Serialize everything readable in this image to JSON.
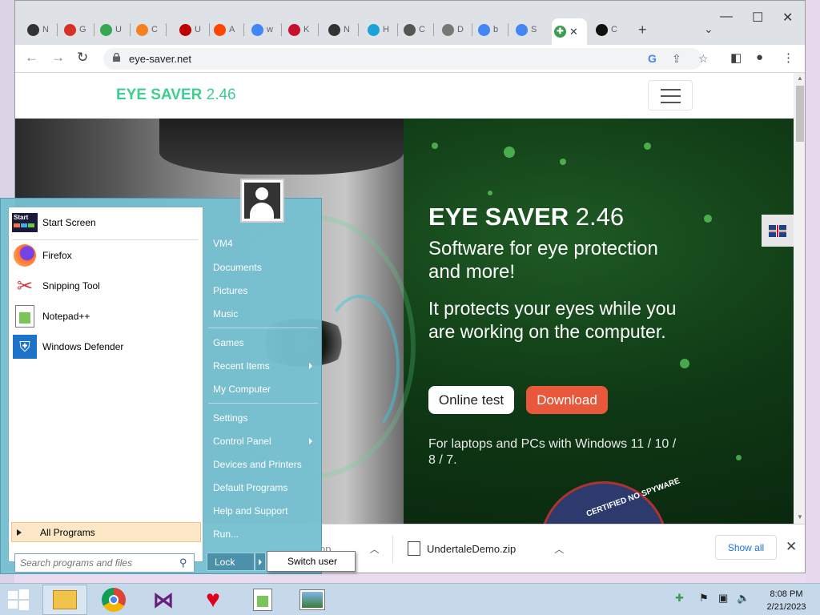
{
  "browser": {
    "tabs": [
      {
        "letter": "N",
        "color": "#333333"
      },
      {
        "letter": "G",
        "color": "#d93025"
      },
      {
        "letter": "U",
        "color": "#34a853"
      },
      {
        "letter": "C",
        "color": "#f48120"
      },
      {
        "letter": "U",
        "color": "#c00000"
      },
      {
        "letter": "A",
        "color": "#ff4500"
      },
      {
        "letter": "w",
        "color": "#4285f4"
      },
      {
        "letter": "K",
        "color": "#c8102e"
      },
      {
        "letter": "N",
        "color": "#333333"
      },
      {
        "letter": "H",
        "color": "#1aa3d9"
      },
      {
        "letter": "C",
        "color": "#555555"
      },
      {
        "letter": "D",
        "color": "#777777"
      },
      {
        "letter": "b",
        "color": "#4285f4"
      },
      {
        "letter": "S",
        "color": "#4285f4"
      },
      {
        "letter": "",
        "color": "#3a9d4f"
      },
      {
        "letter": "C",
        "color": "#111111"
      }
    ],
    "url": "eye-saver.net",
    "new_tab": "+",
    "tab_menu": "⌄",
    "win_minimize": "—",
    "win_maximize": "☐",
    "win_close": "✕"
  },
  "site": {
    "brand_name": "EYE SAVER",
    "brand_version": "2.46",
    "hero_title_name": "EYE SAVER",
    "hero_title_version": "2.46",
    "hero_subtitle": "Software for eye protection and more!",
    "hero_description": "It protects your eyes while you are working on the computer.",
    "online_test_label": "Online test",
    "download_label": "Download",
    "note": "For laptops and PCs with Windows 11 / 10 / 8 / 7.",
    "badge_text": "CERTIFIED NO SPYWARE",
    "accent_color": "#3ccf8e",
    "download_color": "#e8583a"
  },
  "downloads": {
    "item1_name": "op",
    "item2_name": "UndertaleDemo.zip",
    "show_all_label": "Show all",
    "close_icon": "✕"
  },
  "start_menu": {
    "pinned": [
      {
        "label": "Start Screen",
        "icon": "start-screen-icon"
      },
      {
        "label": "Firefox",
        "icon": "firefox-icon"
      },
      {
        "label": "Snipping Tool",
        "icon": "snipping-tool-icon"
      },
      {
        "label": "Notepad++",
        "icon": "notepadpp-icon"
      },
      {
        "label": "Windows Defender",
        "icon": "defender-icon"
      }
    ],
    "start_icon_text": "Start",
    "all_programs_label": "All Programs",
    "search_placeholder": "Search programs and files",
    "right_items": [
      {
        "label": "VM4"
      },
      {
        "label": "Documents"
      },
      {
        "label": "Pictures"
      },
      {
        "label": "Music"
      },
      {
        "label": "Games"
      },
      {
        "label": "Recent Items",
        "submenu": true
      },
      {
        "label": "My Computer"
      },
      {
        "label": "Settings"
      },
      {
        "label": "Control Panel",
        "submenu": true
      },
      {
        "label": "Devices and Printers"
      },
      {
        "label": "Default Programs"
      },
      {
        "label": "Help and Support"
      },
      {
        "label": "Run..."
      }
    ],
    "lock_label": "Lock",
    "switch_user_label": "Switch user"
  },
  "taskbar": {
    "apps": [
      "file-explorer-icon",
      "chrome-icon",
      "visual-studio-icon",
      "undertale-heart-icon",
      "notepadpp-icon",
      "image-viewer-icon"
    ],
    "time": "8:08 PM",
    "date": "2/21/2023"
  }
}
